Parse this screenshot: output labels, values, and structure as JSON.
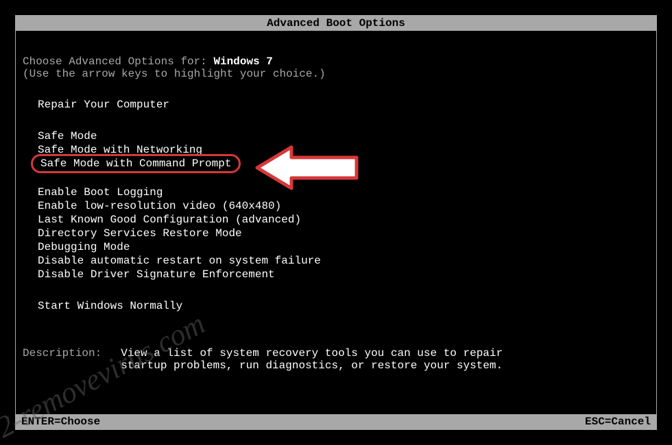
{
  "title": "Advanced Boot Options",
  "prompt": {
    "prefix": "Choose Advanced Options for: ",
    "os": "Windows 7",
    "hint": "(Use the arrow keys to highlight your choice.)"
  },
  "group_repair": [
    "Repair Your Computer"
  ],
  "group_safe": [
    "Safe Mode",
    "Safe Mode with Networking",
    "Safe Mode with Command Prompt"
  ],
  "selected_index": 2,
  "group_other": [
    "Enable Boot Logging",
    "Enable low-resolution video (640x480)",
    "Last Known Good Configuration (advanced)",
    "Directory Services Restore Mode",
    "Debugging Mode",
    "Disable automatic restart on system failure",
    "Disable Driver Signature Enforcement"
  ],
  "group_normal": [
    "Start Windows Normally"
  ],
  "description": {
    "label": "Description:",
    "text_line1": "View a list of system recovery tools you can use to repair",
    "text_line2": "startup problems, run diagnostics, or restore your system."
  },
  "footer": {
    "left": "ENTER=Choose",
    "right": "ESC=Cancel"
  },
  "watermark": "2-removevirus.com",
  "colors": {
    "highlight": "#d63838",
    "bg": "#000000",
    "chrome": "#a8a8a8",
    "bright": "#ffffff"
  }
}
